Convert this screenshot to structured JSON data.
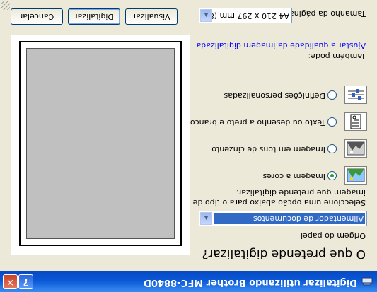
{
  "window": {
    "title": "Digitalizar utilizando Brother MFC-8840D",
    "help_symbol": "?",
    "close_symbol": "✕"
  },
  "question": "O que pretende digitalizar?",
  "source": {
    "label": "Origem do papel",
    "selected": "Alimentador de documentos",
    "arrow": "▲"
  },
  "instructions": "Seleccione uma opção abaixo para o tipo de imagem que pretende digitalizar.",
  "options": [
    {
      "label": "Imagem a cores",
      "icon": "color-picture-icon",
      "checked": true
    },
    {
      "label": "Imagem em tons de cinzento",
      "icon": "grayscale-picture-icon",
      "checked": false
    },
    {
      "label": "Texto ou desenho a preto e branco",
      "icon": "black-white-text-icon",
      "checked": false
    },
    {
      "label": "Definições personalizadas",
      "icon": "custom-settings-icon",
      "checked": false
    }
  ],
  "also": {
    "label": "Também pode:",
    "link": "Ajustar a qualidade da imagem digitalizada"
  },
  "page_size": {
    "label": "Tamanho da página:",
    "value": "A4 210 x 297 mm (8.3",
    "arrow": "▲"
  },
  "buttons": {
    "preview": "Visualizar",
    "scan": "Digitalizar",
    "cancel": "Cancelar"
  },
  "colors": {
    "titlebar": "#0a58d6",
    "selection": "#316ac5",
    "dialog": "#ece9d8"
  }
}
